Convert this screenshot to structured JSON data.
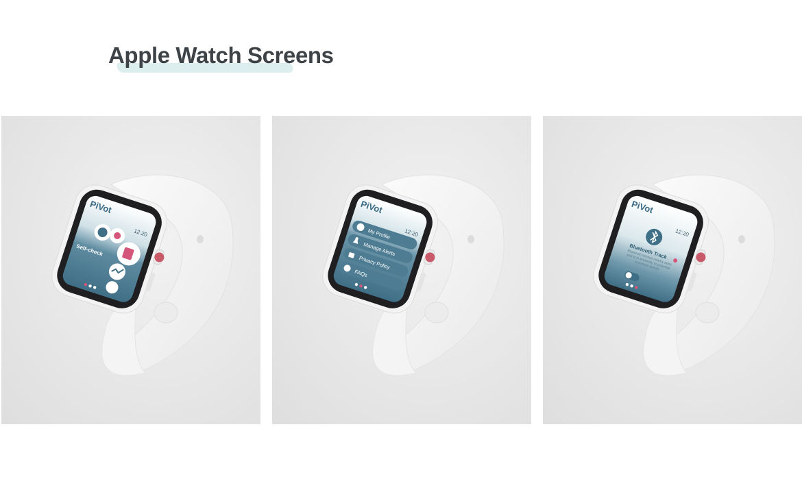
{
  "page": {
    "title": "Apple Watch Screens"
  },
  "colors": {
    "accent_pink": "#d4567a",
    "screen_teal": "#4f7d93",
    "title": "#3e4347",
    "brush": "#dcefee"
  },
  "watches": [
    {
      "screen": "self-check",
      "logo": "PiVot",
      "time": "12:20",
      "label": "Self-check",
      "page_dots": 3,
      "active_dot": 0
    },
    {
      "screen": "menu",
      "logo": "PiVot",
      "time": "12:20",
      "menu": [
        {
          "label": "My Profile",
          "icon": "user-icon"
        },
        {
          "label": "Manage Alerts",
          "icon": "bell-icon"
        },
        {
          "label": "Privacy Policy",
          "icon": "lock-icon"
        },
        {
          "label": "FAQs",
          "icon": "question-icon"
        }
      ],
      "page_dots": 3,
      "active_dot": 1
    },
    {
      "screen": "bluetooth",
      "logo": "PiVot",
      "time": "12:20",
      "heading": "Bluetooth Track",
      "description": "Bluetooth senses nearby apps you're in proximity to potential exposure events",
      "toggle_on": true,
      "page_dots": 3,
      "active_dot": 2
    }
  ]
}
